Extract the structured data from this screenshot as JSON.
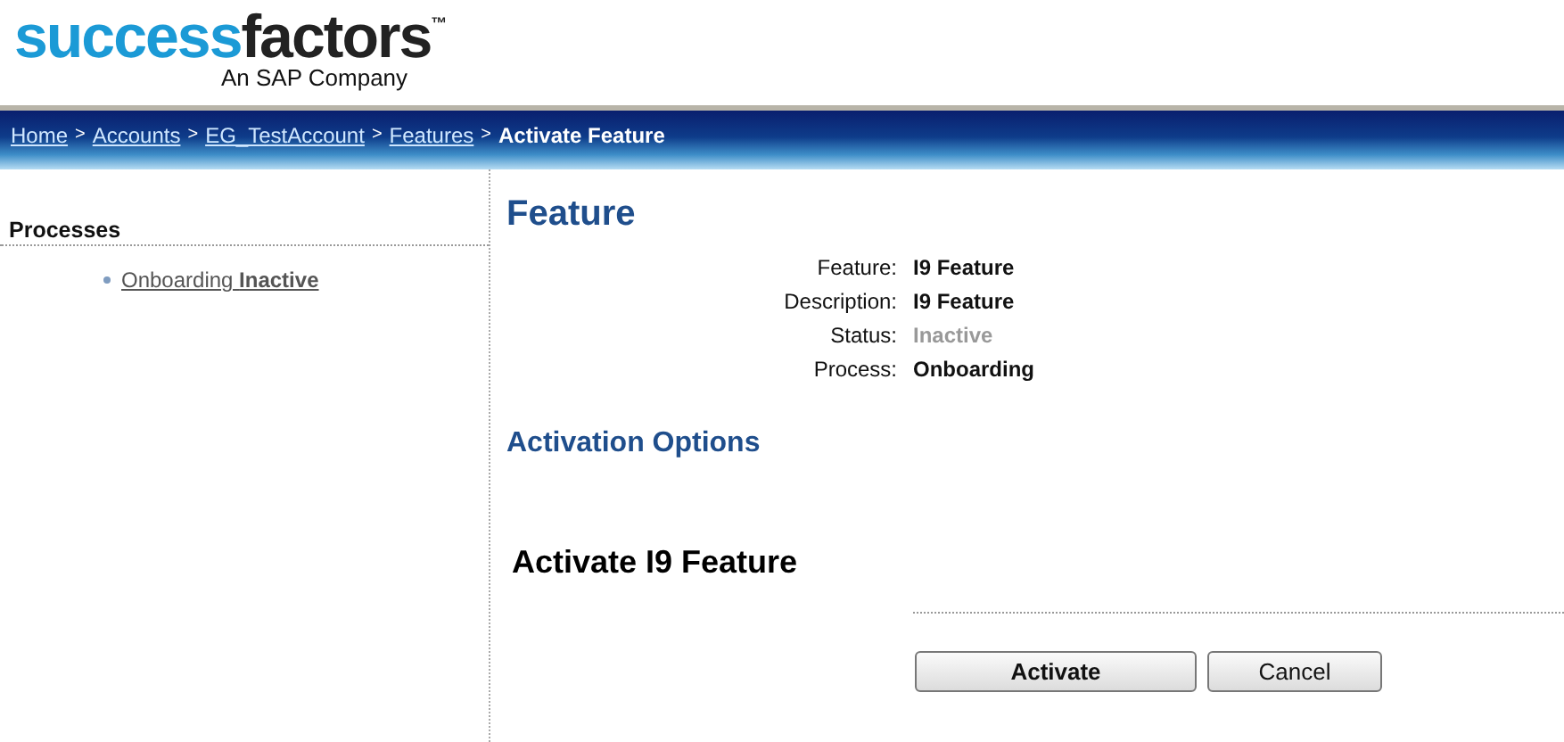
{
  "logo": {
    "parts": [
      "success",
      "factors"
    ],
    "trademark": "™",
    "tagline": "An SAP Company"
  },
  "breadcrumb": {
    "links": [
      "Home",
      "Accounts",
      "EG_TestAccount",
      "Features"
    ],
    "separator": ">",
    "current": "Activate Feature"
  },
  "sidebar": {
    "title": "Processes",
    "items": [
      {
        "label": "Onboarding **Inactive**"
      }
    ]
  },
  "feature": {
    "title": "Feature",
    "details": [
      {
        "label": "Feature:",
        "value": "I9 Feature",
        "muted": false
      },
      {
        "label": "Description:",
        "value": "I9 Feature",
        "muted": false
      },
      {
        "label": "Status:",
        "value": "Inactive",
        "muted": true
      },
      {
        "label": "Process:",
        "value": "Onboarding",
        "muted": false
      }
    ]
  },
  "activation": {
    "title": "Activation Options",
    "heading": "Activate I9 Feature",
    "buttons": [
      {
        "label": "Activate",
        "primary": true
      },
      {
        "label": "Cancel",
        "primary": false
      }
    ]
  }
}
